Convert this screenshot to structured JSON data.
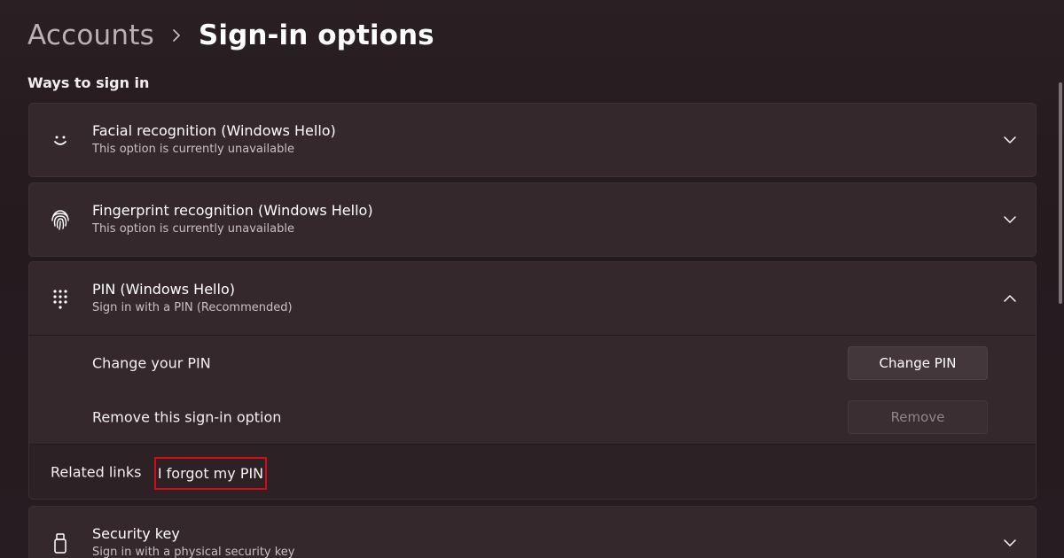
{
  "breadcrumb": {
    "parent": "Accounts",
    "current": "Sign-in options"
  },
  "section_title": "Ways to sign in",
  "options": {
    "facial": {
      "title": "Facial recognition (Windows Hello)",
      "subtitle": "This option is currently unavailable",
      "icon": "smile-icon",
      "expanded": false
    },
    "fingerprint": {
      "title": "Fingerprint recognition (Windows Hello)",
      "subtitle": "This option is currently unavailable",
      "icon": "fingerprint-icon",
      "expanded": false
    },
    "pin": {
      "title": "PIN (Windows Hello)",
      "subtitle": "Sign in with a PIN (Recommended)",
      "icon": "keypad-icon",
      "expanded": true,
      "change_label": "Change your PIN",
      "change_button": "Change PIN",
      "remove_label": "Remove this sign-in option",
      "remove_button": "Remove",
      "related_label": "Related links",
      "forgot_link": "I forgot my PIN"
    },
    "security_key": {
      "title": "Security key",
      "subtitle": "Sign in with a physical security key",
      "icon": "usb-key-icon",
      "expanded": false
    }
  },
  "colors": {
    "highlight_border": "#d40b16",
    "card_background": "#34282c",
    "page_background": "#271c21"
  }
}
